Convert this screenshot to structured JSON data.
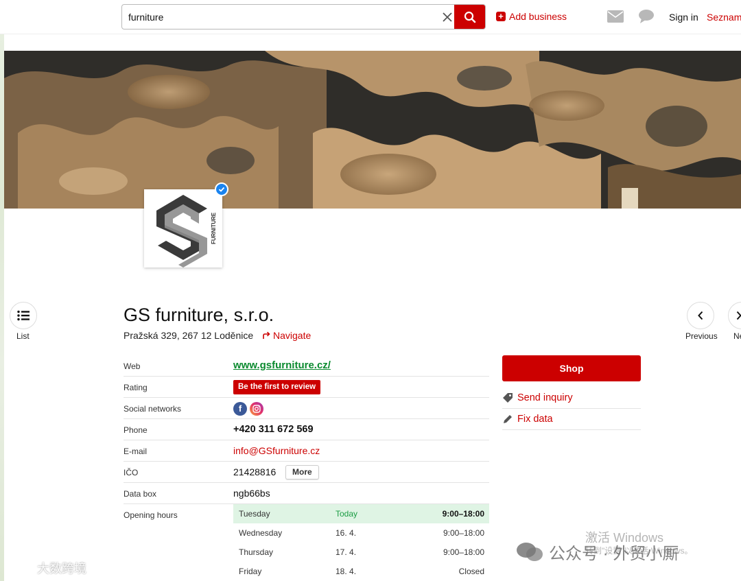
{
  "header": {
    "search_value": "furniture",
    "add_business": "Add business",
    "sign_in": "Sign in",
    "seznam": "Seznam.",
    "icons": [
      "clear-icon",
      "search-icon",
      "mail-icon",
      "chat-icon"
    ]
  },
  "nav": {
    "list": "List",
    "previous": "Previous",
    "next": "Ne"
  },
  "logo": {
    "text": "FURNITURE"
  },
  "company": {
    "name": "GS furniture, s.r.o.",
    "address": "Pražská 329, 267 12 Loděnice",
    "navigate": "Navigate"
  },
  "info": {
    "web_label": "Web",
    "web_value": "www.gsfurniture.cz/",
    "rating_label": "Rating",
    "rating_button": "Be the first to review",
    "social_label": "Social networks",
    "facebook_glyph": "f",
    "phone_label": "Phone",
    "phone_value": "+420 311 672 569",
    "email_label": "E-mail",
    "email_value": "info@GSfurniture.cz",
    "ico_label": "IČO",
    "ico_value": "21428816",
    "more_button": "More",
    "databox_label": "Data box",
    "databox_value": "ngb66bs",
    "hours_label": "Opening hours"
  },
  "hours": [
    {
      "day": "Tuesday",
      "date": "Today",
      "time": "9:00–18:00",
      "today": true
    },
    {
      "day": "Wednesday",
      "date": "16. 4.",
      "time": "9:00–18:00",
      "today": false
    },
    {
      "day": "Thursday",
      "date": "17. 4.",
      "time": "9:00–18:00",
      "today": false
    },
    {
      "day": "Friday",
      "date": "18. 4.",
      "time": "Closed",
      "today": false
    }
  ],
  "actions": {
    "shop": "Shop",
    "send_inquiry": "Send inquiry",
    "fix_data": "Fix data"
  },
  "watermarks": {
    "activate_windows": "激活 Windows",
    "activate_hint": "转到\"设置\"以激活 Windows。",
    "wechat": "公众号 · 外贸小厮",
    "left_logo": "大数跨境"
  },
  "colors": {
    "brand_red": "#cc0000",
    "link_green": "#0b8a2f",
    "today_bg": "#dff4e4",
    "verified_blue": "#1a84f0"
  }
}
